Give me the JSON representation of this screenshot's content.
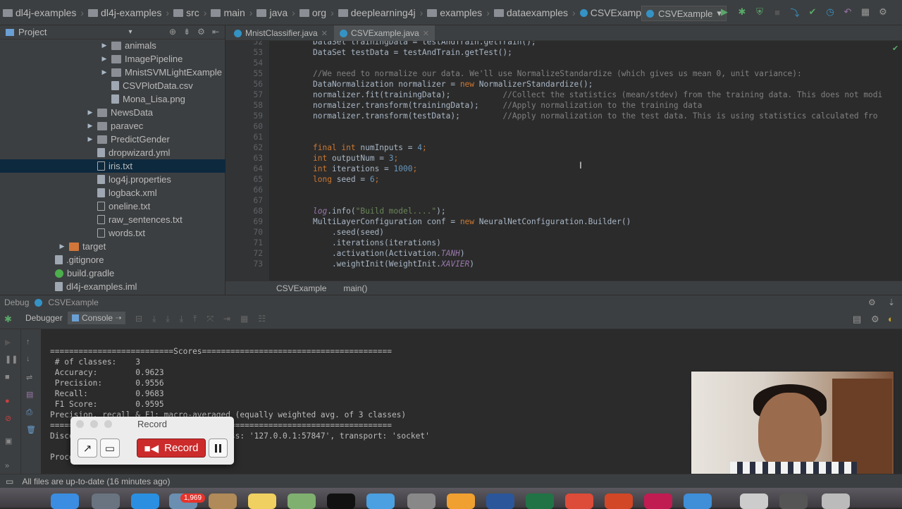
{
  "navbar": {
    "breadcrumbs": [
      "dl4j-examples",
      "dl4j-examples",
      "src",
      "main",
      "java",
      "org",
      "deeplearning4j",
      "examples",
      "dataexamples",
      "CSVExample"
    ],
    "run_config": "CSVExample"
  },
  "project": {
    "header": "Project",
    "items": [
      {
        "label": "animals",
        "type": "folder",
        "indent": 1,
        "arrow": true
      },
      {
        "label": "ImagePipeline",
        "type": "folder",
        "indent": 1,
        "arrow": true
      },
      {
        "label": "MnistSVMLightExample",
        "type": "folder",
        "indent": 1,
        "arrow": true
      },
      {
        "label": "CSVPlotData.csv",
        "type": "file",
        "indent": 1,
        "arrow": false
      },
      {
        "label": "Mona_Lisa.png",
        "type": "file",
        "indent": 1,
        "arrow": false
      },
      {
        "label": "NewsData",
        "type": "folder",
        "indent": 0,
        "arrow": true
      },
      {
        "label": "paravec",
        "type": "folder",
        "indent": 0,
        "arrow": true
      },
      {
        "label": "PredictGender",
        "type": "folder",
        "indent": 0,
        "arrow": true
      },
      {
        "label": "dropwizard.yml",
        "type": "file",
        "indent": 0,
        "arrow": false
      },
      {
        "label": "iris.txt",
        "type": "txt",
        "indent": 0,
        "arrow": false,
        "selected": true
      },
      {
        "label": "log4j.properties",
        "type": "file",
        "indent": 0,
        "arrow": false
      },
      {
        "label": "logback.xml",
        "type": "file",
        "indent": 0,
        "arrow": false
      },
      {
        "label": "oneline.txt",
        "type": "txt",
        "indent": 0,
        "arrow": false
      },
      {
        "label": "raw_sentences.txt",
        "type": "txt",
        "indent": 0,
        "arrow": false
      },
      {
        "label": "words.txt",
        "type": "txt",
        "indent": 0,
        "arrow": false
      },
      {
        "label": "target",
        "type": "target",
        "indent": -2,
        "arrow": true
      },
      {
        "label": ".gitignore",
        "type": "file",
        "indent": -3,
        "arrow": false
      },
      {
        "label": "build.gradle",
        "type": "gradle",
        "indent": -3,
        "arrow": false
      },
      {
        "label": "dl4j-examples.iml",
        "type": "file",
        "indent": -3,
        "arrow": false
      }
    ]
  },
  "tabs": [
    {
      "label": "MnistClassifier.java",
      "active": false
    },
    {
      "label": "CSVExample.java",
      "active": true
    }
  ],
  "code_lines": [
    {
      "n": "52",
      "segs": [
        [
          "t",
          "DataSet trainingData = testAndTrain.getTrain();"
        ]
      ]
    },
    {
      "n": "53",
      "segs": [
        [
          "t",
          "DataSet testData = testAndTrain.getTest();"
        ]
      ]
    },
    {
      "n": "54",
      "segs": []
    },
    {
      "n": "55",
      "segs": [
        [
          "cm",
          "//We need to normalize our data. We'll use NormalizeStandardize (which gives us mean 0, unit variance):"
        ]
      ]
    },
    {
      "n": "56",
      "segs": [
        [
          "t",
          "DataNormalization normalizer = "
        ],
        [
          "kw",
          "new "
        ],
        [
          "t",
          "NormalizerStandardize();"
        ]
      ]
    },
    {
      "n": "57",
      "segs": [
        [
          "t",
          "normalizer.fit(trainingData);           "
        ],
        [
          "cm",
          "//Collect the statistics (mean/stdev) from the training data. This does not modi"
        ]
      ]
    },
    {
      "n": "58",
      "segs": [
        [
          "t",
          "normalizer.transform(trainingData);     "
        ],
        [
          "cm",
          "//Apply normalization to the training data"
        ]
      ]
    },
    {
      "n": "59",
      "segs": [
        [
          "t",
          "normalizer.transform(testData);         "
        ],
        [
          "cm",
          "//Apply normalization to the test data. This is using statistics calculated fro"
        ]
      ]
    },
    {
      "n": "60",
      "segs": []
    },
    {
      "n": "61",
      "segs": []
    },
    {
      "n": "62",
      "segs": [
        [
          "kw",
          "final int "
        ],
        [
          "t",
          "numInputs = "
        ],
        [
          "num",
          "4"
        ],
        [
          "kw",
          ";"
        ]
      ]
    },
    {
      "n": "63",
      "segs": [
        [
          "kw",
          "int "
        ],
        [
          "t",
          "outputNum = "
        ],
        [
          "num",
          "3"
        ],
        [
          "kw",
          ";"
        ]
      ]
    },
    {
      "n": "64",
      "segs": [
        [
          "kw",
          "int "
        ],
        [
          "t",
          "iterations = "
        ],
        [
          "num",
          "1000"
        ],
        [
          "kw",
          ";"
        ]
      ]
    },
    {
      "n": "65",
      "segs": [
        [
          "kw",
          "long "
        ],
        [
          "t",
          "seed = "
        ],
        [
          "num",
          "6"
        ],
        [
          "kw",
          ";"
        ]
      ]
    },
    {
      "n": "66",
      "segs": []
    },
    {
      "n": "67",
      "segs": []
    },
    {
      "n": "68",
      "segs": [
        [
          "lg",
          "log"
        ],
        [
          "t",
          ".info("
        ],
        [
          "str",
          "\"Build model....\""
        ],
        [
          "t",
          ");"
        ]
      ]
    },
    {
      "n": "69",
      "segs": [
        [
          "t",
          "MultiLayerConfiguration conf = "
        ],
        [
          "kw",
          "new "
        ],
        [
          "t",
          "NeuralNetConfiguration.Builder()"
        ]
      ]
    },
    {
      "n": "70",
      "segs": [
        [
          "t",
          "    .seed(seed)"
        ]
      ]
    },
    {
      "n": "71",
      "segs": [
        [
          "t",
          "    .iterations(iterations)"
        ]
      ]
    },
    {
      "n": "72",
      "segs": [
        [
          "t",
          "    .activation("
        ],
        [
          "t",
          "Activation."
        ],
        [
          "it",
          "TANH"
        ],
        [
          "t",
          ")"
        ]
      ]
    },
    {
      "n": "73",
      "segs": [
        [
          "t",
          "    .weightInit(WeightInit."
        ],
        [
          "it",
          "XAVIER"
        ],
        [
          "t",
          ")"
        ]
      ]
    }
  ],
  "editor_breadcrumb": [
    "CSVExample",
    "main()"
  ],
  "debug": {
    "title_label": "Debug",
    "config_name": "CSVExample",
    "tab_debugger": "Debugger",
    "tab_console": "Console"
  },
  "console_lines": [
    "==========================Scores========================================",
    " # of classes:    3",
    " Accuracy:        0.9623",
    " Precision:       0.9556",
    " Recall:          0.9683",
    " F1 Score:        0.9595",
    "Precision, recall & F1: macro-averaged (equally weighted avg. of 3 classes)",
    "========================================================================",
    "Disconnected from the target VM, address: '127.0.0.1:57847', transport: 'socket'",
    "",
    "Process finished with exit code 0"
  ],
  "record_widget": {
    "title": "Record",
    "record_label": "Record"
  },
  "status": {
    "message": "All files are up-to-date (16 minutes ago)"
  },
  "dock": {
    "badge": "1,969"
  },
  "colors": {
    "ide_bg": "#2b2b2b",
    "panel_bg": "#3c3f41",
    "selection": "#0d293e",
    "record_red": "#cc2b2b",
    "keyword": "#cc7832",
    "string": "#6a8759",
    "number": "#6897bb",
    "comment": "#808080"
  }
}
